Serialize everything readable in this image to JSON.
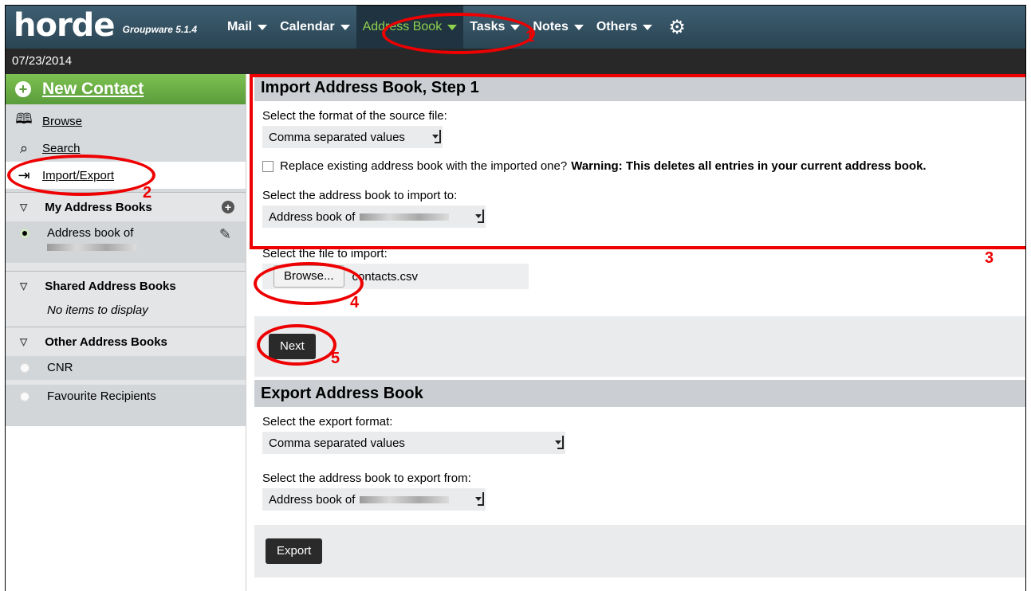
{
  "app": {
    "logo": "horde",
    "version": "Groupware 5.1.4",
    "date": "07/23/2014"
  },
  "nav": [
    {
      "label": "Mail"
    },
    {
      "label": "Calendar"
    },
    {
      "label": "Address Book",
      "active": true
    },
    {
      "label": "Tasks"
    },
    {
      "label": "Notes"
    },
    {
      "label": "Others"
    }
  ],
  "sidebar": {
    "new_contact": "New Contact",
    "links": [
      {
        "label": "Browse",
        "icon": "book-icon"
      },
      {
        "label": "Search",
        "icon": "search-icon"
      },
      {
        "label": "Import/Export",
        "icon": "import-export-icon",
        "selected": true
      }
    ],
    "my_books": {
      "title": "My Address Books",
      "item": "Address book of"
    },
    "shared_books": {
      "title": "Shared Address Books",
      "empty": "No items to display"
    },
    "other_books": {
      "title": "Other Address Books",
      "items": [
        "CNR",
        "Favourite Recipients"
      ]
    }
  },
  "import": {
    "title": "Import Address Book, Step 1",
    "format_label": "Select the format of the source file:",
    "format_value": "Comma separated values",
    "replace_label": "Replace existing address book with the imported one?",
    "replace_warning": "Warning: This deletes all entries in your current address book.",
    "book_label": "Select the address book to import to:",
    "book_value": "Address book of",
    "file_label": "Select the file to import:",
    "browse_label": "Browse...",
    "file_name": "contacts.csv",
    "next_label": "Next"
  },
  "export": {
    "title": "Export Address Book",
    "format_label": "Select the export format:",
    "format_value": "Comma separated values",
    "book_label": "Select the address book to export from:",
    "book_value": "Address book of",
    "export_label": "Export"
  },
  "annotations": [
    "1",
    "2",
    "3",
    "4",
    "5"
  ],
  "colors": {
    "annotation": "#e00000",
    "active_nav": "#8fd14f",
    "new_contact": "#6cae45"
  }
}
